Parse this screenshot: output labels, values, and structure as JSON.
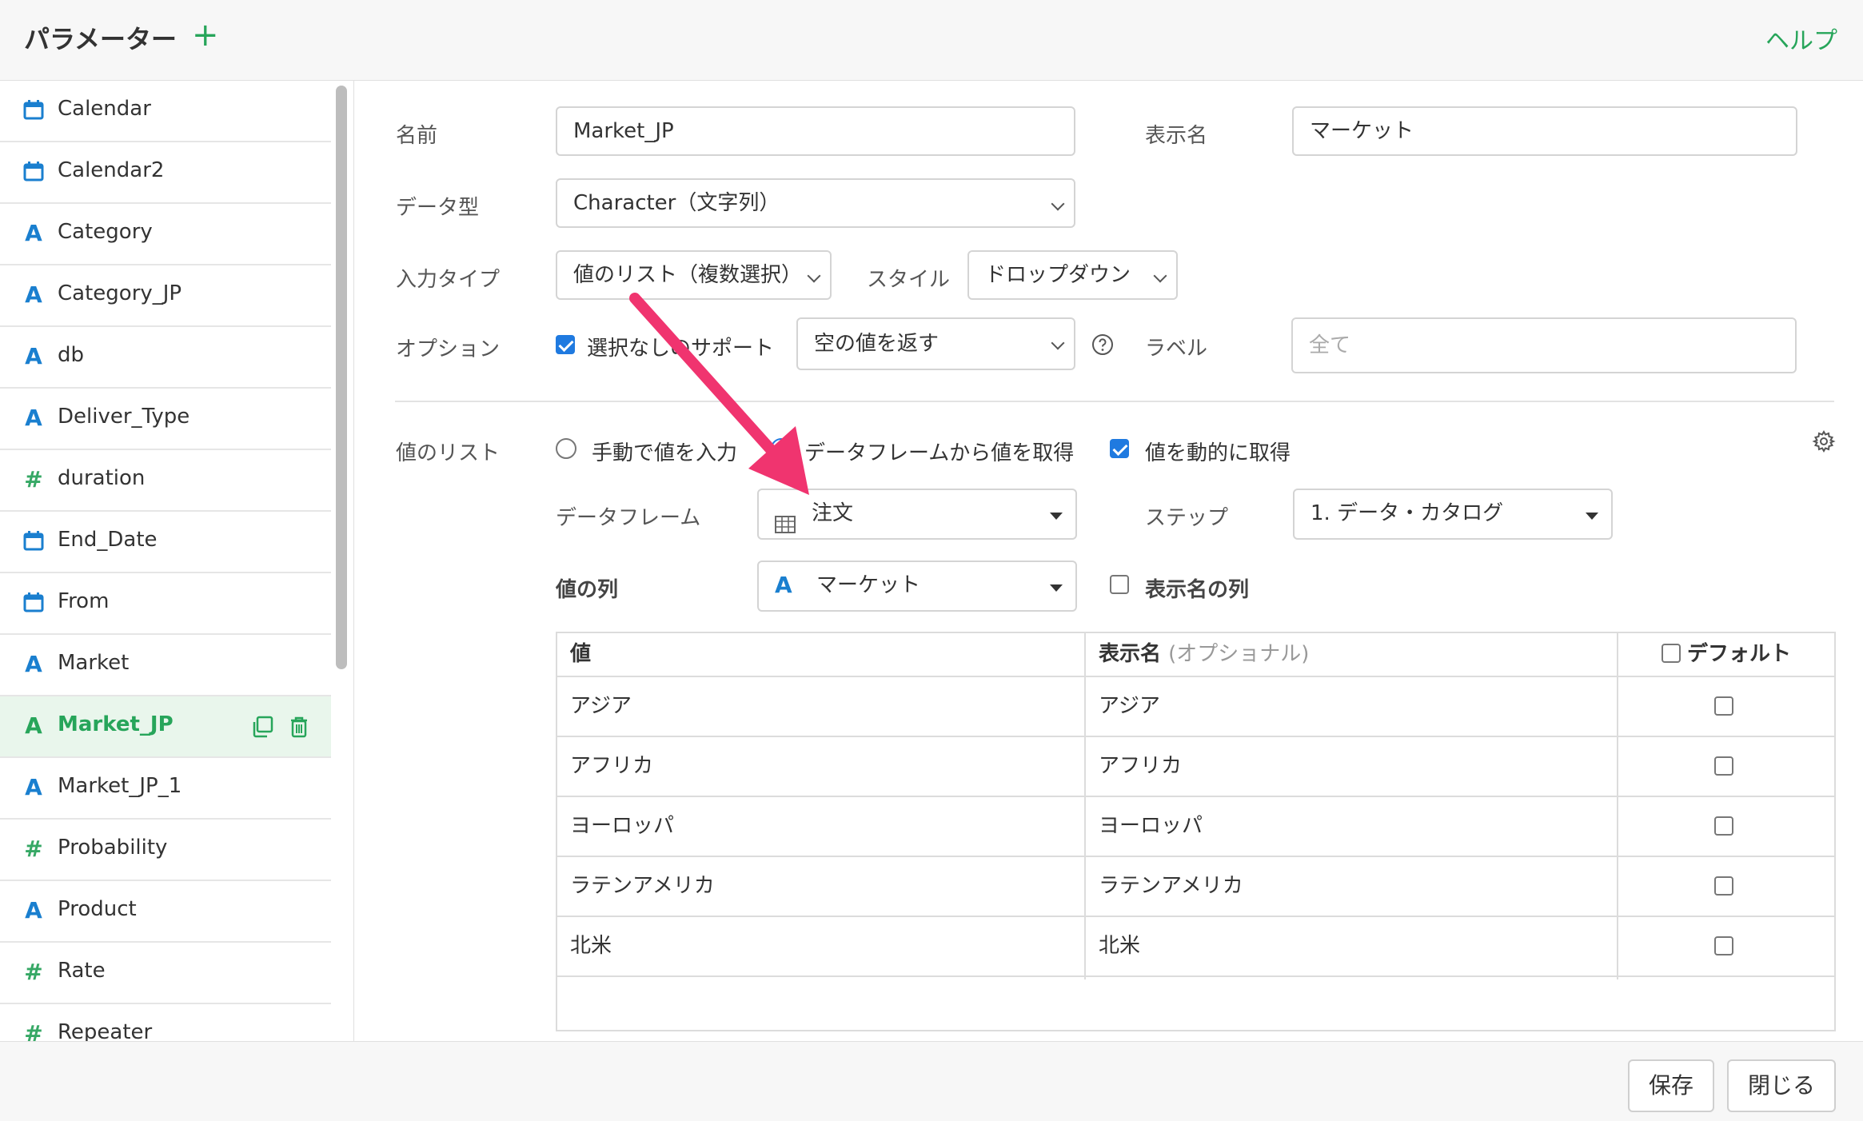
{
  "header": {
    "title": "パラメーター",
    "add_icon": "plus-icon",
    "help": "ヘルプ"
  },
  "sidebar": {
    "items": [
      {
        "label": "Calendar",
        "icon": "calendar-icon"
      },
      {
        "label": "Calendar2",
        "icon": "calendar-icon"
      },
      {
        "label": "Category",
        "icon": "character-type-icon"
      },
      {
        "label": "Category_JP",
        "icon": "character-type-icon"
      },
      {
        "label": "db",
        "icon": "character-type-icon"
      },
      {
        "label": "Deliver_Type",
        "icon": "character-type-icon"
      },
      {
        "label": "duration",
        "icon": "numeric-type-icon"
      },
      {
        "label": "End_Date",
        "icon": "calendar-icon"
      },
      {
        "label": "From",
        "icon": "calendar-icon"
      },
      {
        "label": "Market",
        "icon": "character-type-icon"
      },
      {
        "label": "Market_JP",
        "icon": "character-type-icon",
        "selected": true
      },
      {
        "label": "Market_JP_1",
        "icon": "character-type-icon"
      },
      {
        "label": "Probability",
        "icon": "numeric-type-icon"
      },
      {
        "label": "Product",
        "icon": "character-type-icon"
      },
      {
        "label": "Rate",
        "icon": "numeric-type-icon"
      },
      {
        "label": "Repeater",
        "icon": "numeric-type-icon"
      }
    ],
    "glyph_A": "A",
    "glyph_hash": "#"
  },
  "form": {
    "name_label": "名前",
    "name_value": "Market_JP",
    "display_name_label": "表示名",
    "display_name_value": "マーケット",
    "data_type_label": "データ型",
    "data_type_value": "Character（文字列）",
    "input_type_label": "入力タイプ",
    "input_type_value": "値のリスト（複数選択）",
    "style_label": "スタイル",
    "style_value": "ドロップダウン",
    "option_label": "オプション",
    "support_none_label": "選択なしのサポート",
    "empty_value_option": "空の値を返す",
    "label_label": "ラベル",
    "label_placeholder": "全て"
  },
  "values_list": {
    "section_label": "値のリスト",
    "manual_label": "手動で値を入力",
    "from_df_label": "データフレームから値を取得",
    "dynamic_label": "値を動的に取得",
    "dataframe_label": "データフレーム",
    "dataframe_value": "注文",
    "step_label": "ステップ",
    "step_value": "1. データ・カタログ",
    "value_column_label": "値の列",
    "value_column_value": "マーケット",
    "display_column_label": "表示名の列"
  },
  "table": {
    "col_value": "値",
    "col_display": "表示名",
    "col_display_optional": "(オプショナル)",
    "col_default": "デフォルト",
    "rows": [
      {
        "value": "アジア",
        "display": "アジア"
      },
      {
        "value": "アフリカ",
        "display": "アフリカ"
      },
      {
        "value": "ヨーロッパ",
        "display": "ヨーロッパ"
      },
      {
        "value": "ラテンアメリカ",
        "display": "ラテンアメリカ"
      },
      {
        "value": "北米",
        "display": "北米"
      }
    ]
  },
  "footer": {
    "save": "保存",
    "close": "閉じる"
  },
  "colors": {
    "accent_green": "#27a55a",
    "blue": "#1f7ae0",
    "arrow_pink": "#f0346f"
  }
}
